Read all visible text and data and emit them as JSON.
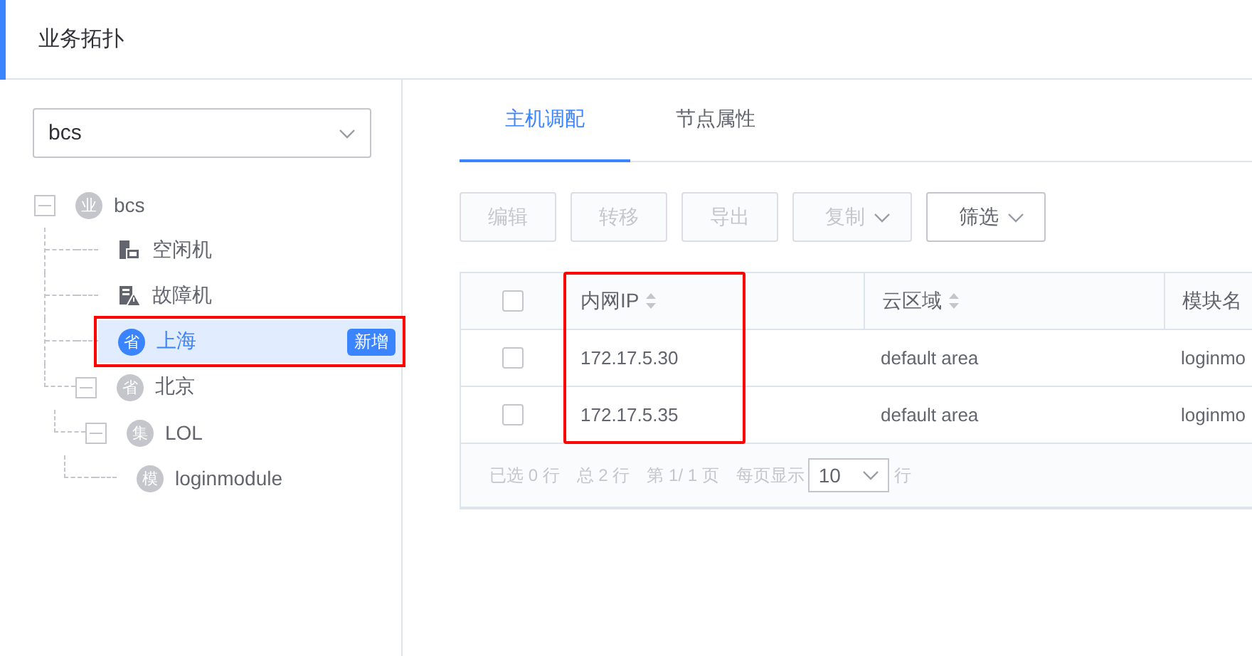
{
  "header": {
    "title": "业务拓扑"
  },
  "sidebar": {
    "business_select": {
      "value": "bcs"
    },
    "tree": [
      {
        "label": "bcs",
        "kind": "circle",
        "icon_text": "业",
        "expanded": true,
        "selected": false,
        "highlighted": false,
        "children": [
          {
            "label": "空闲机",
            "kind": "idle",
            "selected": false,
            "highlighted": false
          },
          {
            "label": "故障机",
            "kind": "fault",
            "selected": false,
            "highlighted": false
          },
          {
            "label": "上海",
            "kind": "circle",
            "icon_text": "省",
            "selected": true,
            "highlighted": true,
            "badge": "新增"
          },
          {
            "label": "北京",
            "kind": "circle",
            "icon_text": "省",
            "expanded": true,
            "selected": false,
            "highlighted": false,
            "children": [
              {
                "label": "LOL",
                "kind": "circle",
                "icon_text": "集",
                "expanded": true,
                "selected": false,
                "highlighted": false,
                "children": [
                  {
                    "label": "loginmodule",
                    "kind": "circle",
                    "icon_text": "模",
                    "selected": false,
                    "highlighted": false
                  }
                ]
              }
            ]
          }
        ]
      }
    ]
  },
  "tabs": [
    {
      "label": "主机调配",
      "selected": true
    },
    {
      "label": "节点属性",
      "selected": false
    }
  ],
  "toolbar": [
    {
      "label": "编辑",
      "disabled": true,
      "dropdown": false
    },
    {
      "label": "转移",
      "disabled": true,
      "dropdown": false
    },
    {
      "label": "导出",
      "disabled": true,
      "dropdown": false
    },
    {
      "label": "复制",
      "disabled": true,
      "dropdown": true
    },
    {
      "label": "筛选",
      "disabled": false,
      "dropdown": true
    }
  ],
  "table": {
    "header_checked": false,
    "columns": [
      {
        "label": "内网IP",
        "sortable": true,
        "highlighted": true
      },
      {
        "label": "云区域",
        "sortable": true,
        "highlighted": false
      },
      {
        "label": "模块名",
        "sortable": false,
        "highlighted": false
      }
    ],
    "rows": [
      {
        "checked": false,
        "cells": [
          "172.17.5.30",
          "default area",
          "loginmo"
        ]
      },
      {
        "checked": false,
        "cells": [
          "172.17.5.35",
          "default area",
          "loginmo"
        ]
      }
    ],
    "footer": {
      "selected": "已选 0 行",
      "total": "总 2 行",
      "page": "第 1/ 1 页",
      "page_size_label": "每页显示",
      "page_size": "10",
      "page_size_unit": "行"
    }
  }
}
